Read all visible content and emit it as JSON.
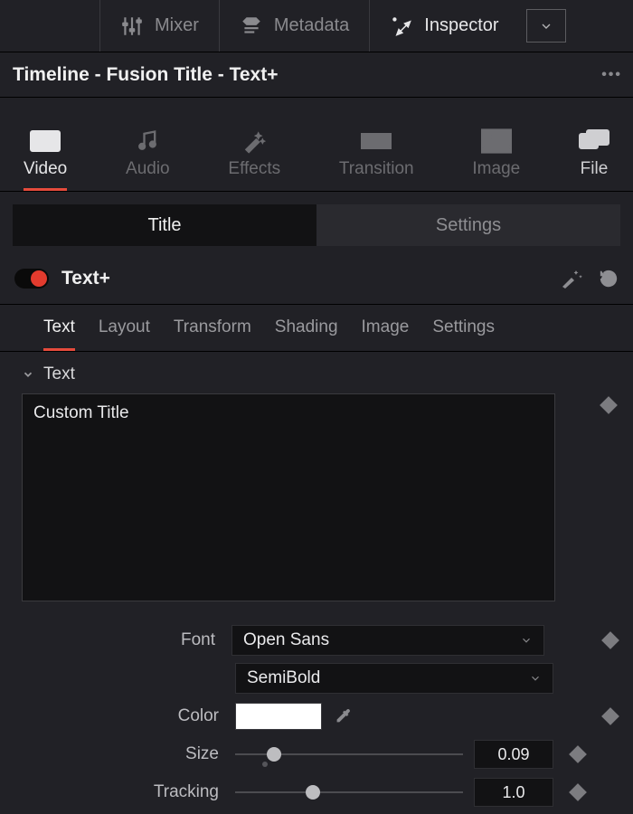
{
  "topbar": {
    "mixer": "Mixer",
    "metadata": "Metadata",
    "inspector": "Inspector"
  },
  "title": "Timeline - Fusion Title - Text+",
  "categories": {
    "video": "Video",
    "audio": "Audio",
    "effects": "Effects",
    "transition": "Transition",
    "image": "Image",
    "file": "File"
  },
  "segments": {
    "title": "Title",
    "settings": "Settings"
  },
  "effect": {
    "name": "Text+"
  },
  "subtabs": {
    "text": "Text",
    "layout": "Layout",
    "transform": "Transform",
    "shading": "Shading",
    "image": "Image",
    "settings": "Settings"
  },
  "section": {
    "header": "Text",
    "text_value": "Custom Title",
    "font_label": "Font",
    "font_family": "Open Sans",
    "font_style": "SemiBold",
    "color_label": "Color",
    "color_value": "#FFFFFF",
    "size_label": "Size",
    "size_value": "0.09",
    "size_fraction": 0.15,
    "tracking_label": "Tracking",
    "tracking_value": "1.0",
    "tracking_fraction": 0.33
  }
}
